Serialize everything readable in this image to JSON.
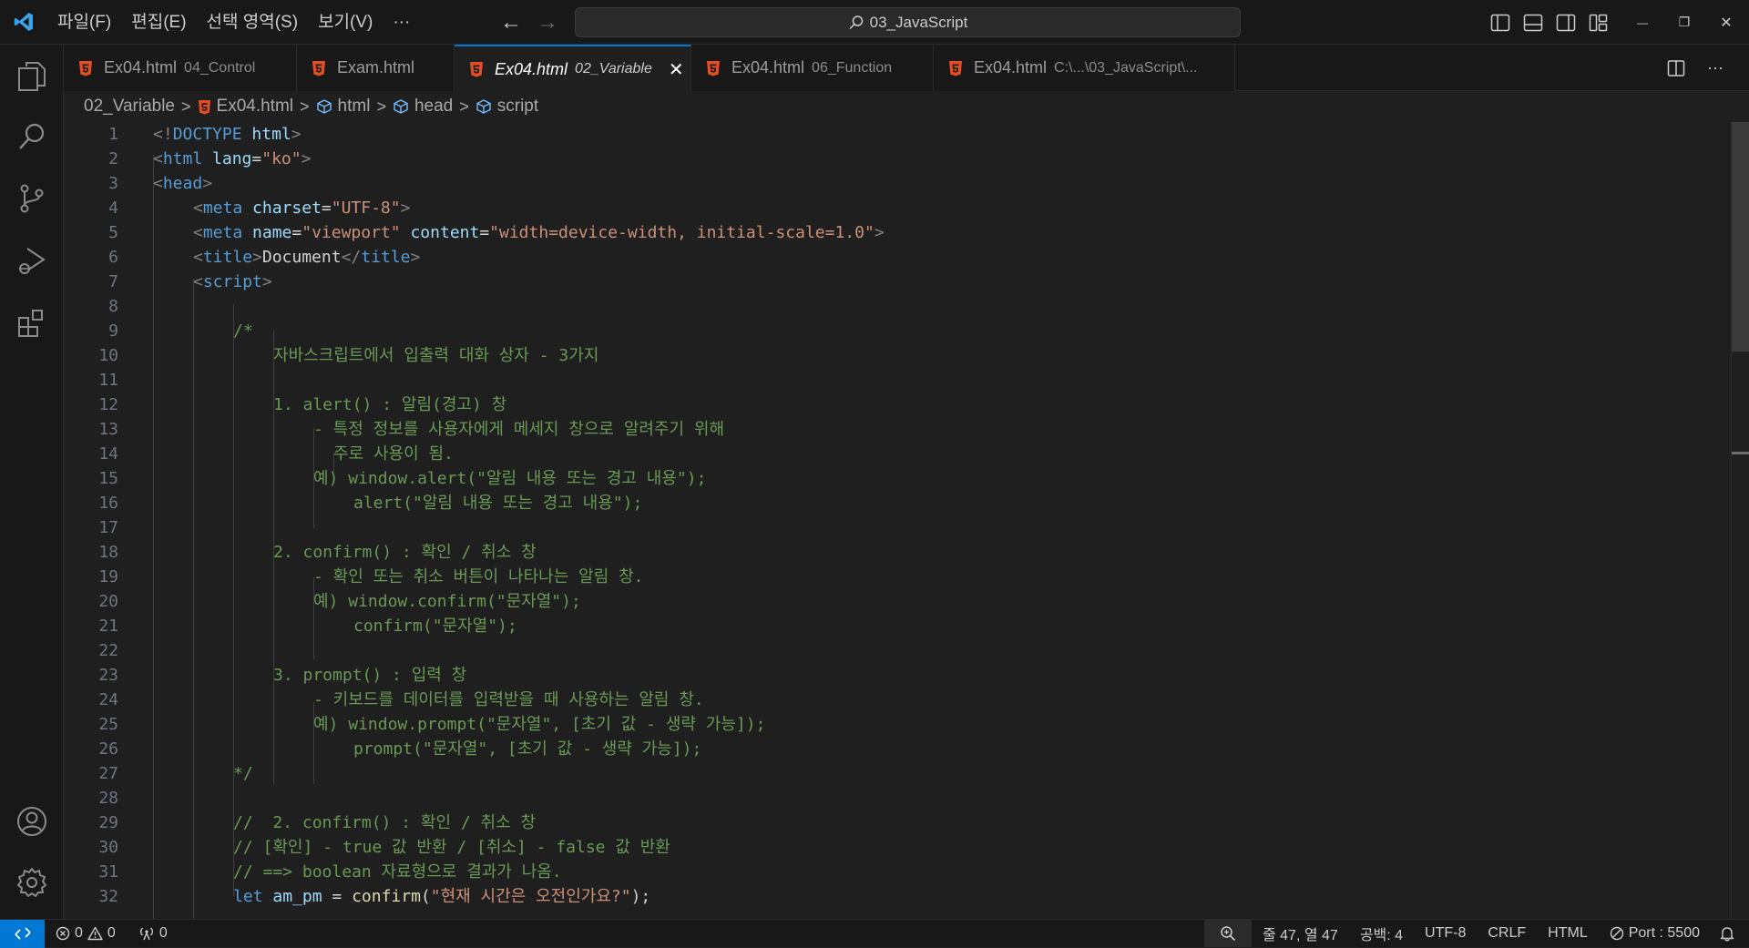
{
  "titlebar": {
    "menu": [
      "파일(F)",
      "편집(E)",
      "선택 영역(S)",
      "보기(V)",
      "···"
    ],
    "back_arrow": "←",
    "forward_arrow": "→",
    "search_text": "03_JavaScript",
    "window_controls": {
      "minimize": "—",
      "restore": "❐",
      "close": "✕"
    }
  },
  "tabs": [
    {
      "name": "Ex04.html",
      "desc": "04_Control"
    },
    {
      "name": "Exam.html",
      "desc": ""
    },
    {
      "name": "Ex04.html",
      "desc": "02_Variable",
      "close": "✕"
    },
    {
      "name": "Ex04.html",
      "desc": "06_Function"
    },
    {
      "name": "Ex04.html",
      "desc": "C:\\...\\03_JavaScript\\..."
    }
  ],
  "tab_actions": {
    "more": "···"
  },
  "breadcrumbs": [
    "02_Variable",
    "Ex04.html",
    "html",
    "head",
    "script"
  ],
  "breadcrumb_sep": ">",
  "code_lines": [
    "1",
    "2",
    "3",
    "4",
    "5",
    "6",
    "7",
    "8",
    "9",
    "10",
    "11",
    "12",
    "13",
    "14",
    "15",
    "16",
    "17",
    "18",
    "19",
    "20",
    "21",
    "22",
    "23",
    "24",
    "25",
    "26",
    "27",
    "28",
    "29",
    "30",
    "31",
    "32"
  ],
  "code": {
    "l1": [
      "<!",
      "DOCTYPE",
      " ",
      "html",
      ">"
    ],
    "l2": [
      "<",
      "html",
      " ",
      "lang",
      "=",
      "\"ko\"",
      ">"
    ],
    "l3": [
      "<",
      "head",
      ">"
    ],
    "l4": [
      "<",
      "meta",
      " ",
      "charset",
      "=",
      "\"UTF-8\"",
      ">"
    ],
    "l5": [
      "<",
      "meta",
      " ",
      "name",
      "=",
      "\"viewport\"",
      " ",
      "content",
      "=",
      "\"width=device-width, initial-scale=1.0\"",
      ">"
    ],
    "l6": [
      "<",
      "title",
      ">",
      "Document",
      "</",
      "title",
      ">"
    ],
    "l7": [
      "<",
      "script",
      ">"
    ],
    "c9": "/*",
    "c10": "자바스크립트에서 입출력 대화 상자 - 3가지",
    "c12": "1. alert() : 알림(경고) 창",
    "c13": "- 특정 정보를 사용자에게 메세지 창으로 알려주기 위해",
    "c14": "주로 사용이 됨.",
    "c15": "예) window.alert(\"알림 내용 또는 경고 내용\");",
    "c16": "alert(\"알림 내용 또는 경고 내용\");",
    "c18": "2. confirm() : 확인 / 취소 창",
    "c19": "- 확인 또는 취소 버튼이 나타나는 알림 창.",
    "c20": "예) window.confirm(\"문자열\");",
    "c21": "confirm(\"문자열\");",
    "c23": "3. prompt() : 입력 창",
    "c24": "- 키보드를 데이터를 입력받을 때 사용하는 알림 창.",
    "c25": "예) window.prompt(\"문자열\", [초기 값 - 생략 가능]);",
    "c26": "prompt(\"문자열\", [초기 값 - 생략 가능]);",
    "c27": "*/",
    "c29": "//  2. confirm() : 확인 / 취소 창",
    "c30": "// [확인] - true 값 반환 / [취소] - false 값 반환",
    "c31": "// ==> boolean 자료형으로 결과가 나옴.",
    "l32": [
      "let",
      " ",
      "am_pm",
      " = ",
      "confirm",
      "(",
      "\"현재 시간은 오전인가요?\"",
      ");"
    ]
  },
  "statusbar": {
    "errors": "0",
    "warnings": "0",
    "ports": "0",
    "position": "줄 47, 열 47",
    "spaces": "공백: 4",
    "encoding": "UTF-8",
    "eol": "CRLF",
    "language": "HTML",
    "port": "Port : 5500"
  },
  "colors": {
    "accent": "#0078d4",
    "html_icon": "#e44d26",
    "vscode_logo": "#3ba1e6"
  }
}
